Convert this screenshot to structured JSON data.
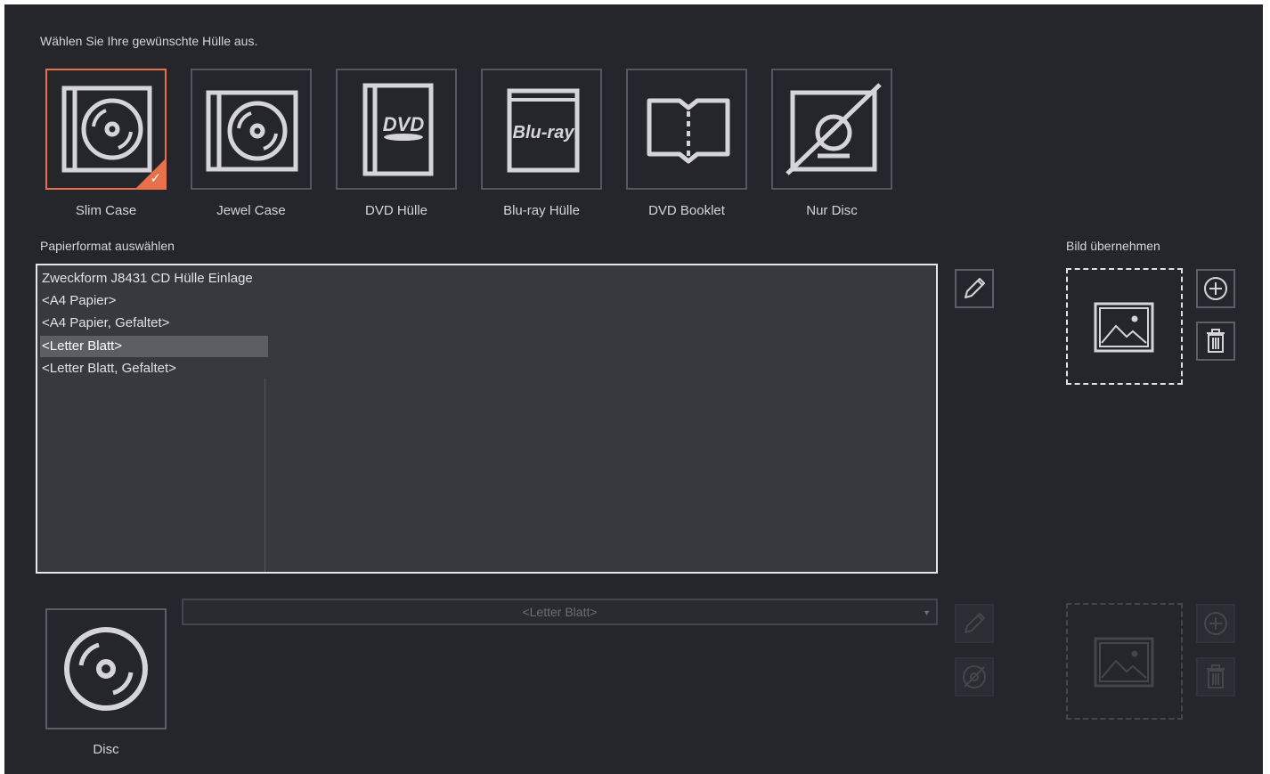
{
  "header": {
    "title": "Wählen Sie Ihre gewünschte Hülle aus."
  },
  "cases": [
    {
      "label": "Slim Case",
      "icon": "slim-case-icon",
      "selected": true
    },
    {
      "label": "Jewel Case",
      "icon": "jewel-case-icon",
      "selected": false
    },
    {
      "label": "DVD Hülle",
      "icon": "dvd-case-icon",
      "selected": false
    },
    {
      "label": "Blu-ray Hülle",
      "icon": "bluray-case-icon",
      "selected": false
    },
    {
      "label": "DVD Booklet",
      "icon": "booklet-icon",
      "selected": false
    },
    {
      "label": "Nur Disc",
      "icon": "no-case-disc-icon",
      "selected": false
    }
  ],
  "case_art": {
    "dvd_logo": "DVD",
    "bluray_logo": "Blu-ray"
  },
  "paper": {
    "title": "Papierformat auswählen",
    "items": [
      "Zweckform J8431 CD Hülle Einlage",
      "<A4 Papier>",
      "<A4 Papier, Gefaltet>",
      "<Letter Blatt>",
      "<Letter Blatt, Gefaltet>"
    ],
    "selected_index": 3
  },
  "image": {
    "title": "Bild übernehmen"
  },
  "disc": {
    "label": "Disc",
    "combo_value": "<Letter Blatt>"
  },
  "colors": {
    "background": "#25262b",
    "accent": "#e8714c",
    "list_background": "#38393e",
    "selection": "#5d5e63"
  }
}
